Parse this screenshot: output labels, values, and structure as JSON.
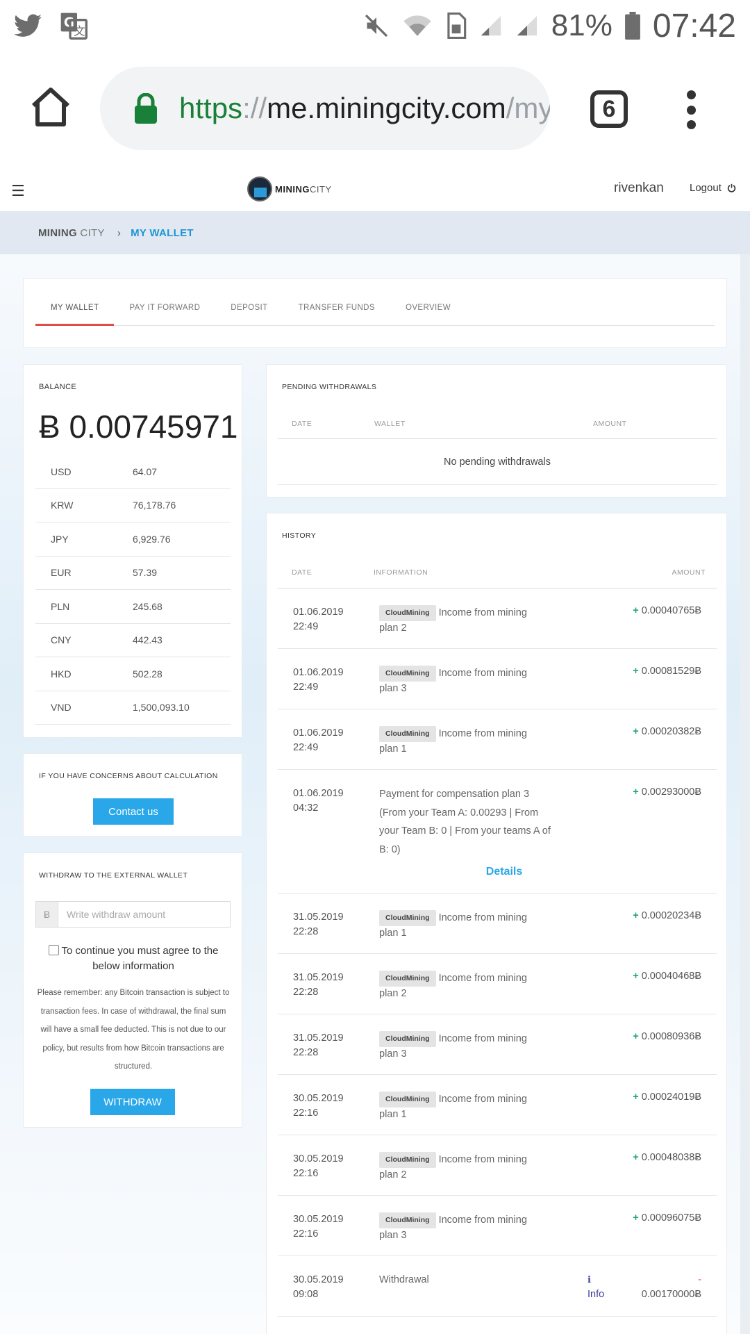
{
  "status_bar": {
    "battery_percent": "81%",
    "time": "07:42"
  },
  "browser": {
    "url_scheme": "https",
    "url_separator": "://",
    "url_host": "me.miningcity.com",
    "url_path": "/my",
    "tab_count": "6"
  },
  "site_header": {
    "logo_text_bold": "MINING",
    "logo_text_light": "CITY",
    "username": "rivenkan",
    "logout_label": "Logout"
  },
  "breadcrumb": {
    "root_bold": "MINING",
    "root_light": " CITY",
    "separator": "›",
    "current": "MY WALLET"
  },
  "tabs": [
    "MY WALLET",
    "PAY IT FORWARD",
    "DEPOSIT",
    "TRANSFER FUNDS",
    "OVERVIEW"
  ],
  "balance": {
    "title": "BALANCE",
    "amount": "Ƀ 0.00745971",
    "currencies": [
      {
        "code": "USD",
        "value": "64.07"
      },
      {
        "code": "KRW",
        "value": "76,178.76"
      },
      {
        "code": "JPY",
        "value": "6,929.76"
      },
      {
        "code": "EUR",
        "value": "57.39"
      },
      {
        "code": "PLN",
        "value": "245.68"
      },
      {
        "code": "CNY",
        "value": "442.43"
      },
      {
        "code": "HKD",
        "value": "502.28"
      },
      {
        "code": "VND",
        "value": "1,500,093.10"
      }
    ]
  },
  "concerns": {
    "title": "IF YOU HAVE CONCERNS ABOUT CALCULATION",
    "button": "Contact us"
  },
  "withdraw": {
    "title": "WITHDRAW TO THE EXTERNAL WALLET",
    "currency_symbol": "Ƀ",
    "placeholder": "Write withdraw amount",
    "agree_text": "To continue you must agree to the below information",
    "notice": "Please remember: any Bitcoin transaction is subject to transaction fees. In case of withdrawal, the final sum will have a small fee deducted. This is not due to our policy, but results from how Bitcoin transactions are structured.",
    "button": "WITHDRAW"
  },
  "pending": {
    "title": "PENDING WITHDRAWALS",
    "col_date": "DATE",
    "col_wallet": "WALLET",
    "col_amount": "AMOUNT",
    "empty_message": "No pending withdrawals"
  },
  "history": {
    "title": "HISTORY",
    "col_date": "DATE",
    "col_information": "INFORMATION",
    "col_amount": "AMOUNT",
    "rows": [
      {
        "date": "01.06.2019",
        "time": "22:49",
        "badge": "CloudMining",
        "info": "Income from mining plan 2",
        "sign": "+",
        "amount": "0.00040765Ƀ"
      },
      {
        "date": "01.06.2019",
        "time": "22:49",
        "badge": "CloudMining",
        "info": "Income from mining plan 3",
        "sign": "+",
        "amount": "0.00081529Ƀ"
      },
      {
        "date": "01.06.2019",
        "time": "22:49",
        "badge": "CloudMining",
        "info": "Income from mining plan 1",
        "sign": "+",
        "amount": "0.00020382Ƀ"
      },
      {
        "date": "01.06.2019",
        "time": "04:32",
        "badge": "",
        "info": "Payment for compensation plan 3 (From your Team A: 0.00293 | From your Team B: 0 | From your teams A of B: 0)",
        "sign": "+",
        "amount": "0.00293000Ƀ",
        "link": "Details"
      },
      {
        "date": "31.05.2019",
        "time": "22:28",
        "badge": "CloudMining",
        "info": "Income from mining plan 1",
        "sign": "+",
        "amount": "0.00020234Ƀ"
      },
      {
        "date": "31.05.2019",
        "time": "22:28",
        "badge": "CloudMining",
        "info": "Income from mining plan 2",
        "sign": "+",
        "amount": "0.00040468Ƀ"
      },
      {
        "date": "31.05.2019",
        "time": "22:28",
        "badge": "CloudMining",
        "info": "Income from mining plan 3",
        "sign": "+",
        "amount": "0.00080936Ƀ"
      },
      {
        "date": "30.05.2019",
        "time": "22:16",
        "badge": "CloudMining",
        "info": "Income from mining plan 1",
        "sign": "+",
        "amount": "0.00024019Ƀ"
      },
      {
        "date": "30.05.2019",
        "time": "22:16",
        "badge": "CloudMining",
        "info": "Income from mining plan 2",
        "sign": "+",
        "amount": "0.00048038Ƀ"
      },
      {
        "date": "30.05.2019",
        "time": "22:16",
        "badge": "CloudMining",
        "info": "Income from mining plan 3",
        "sign": "+",
        "amount": "0.00096075Ƀ"
      },
      {
        "date": "30.05.2019",
        "time": "09:08",
        "badge": "",
        "info": "Withdrawal",
        "sign": "-",
        "amount": "0.00170000Ƀ",
        "info_link": "Info"
      }
    ]
  },
  "colors": {
    "accent_blue": "#2aa7e8",
    "tab_underline": "#e04b4b",
    "positive": "#22a184",
    "negative": "#e05a5a"
  }
}
